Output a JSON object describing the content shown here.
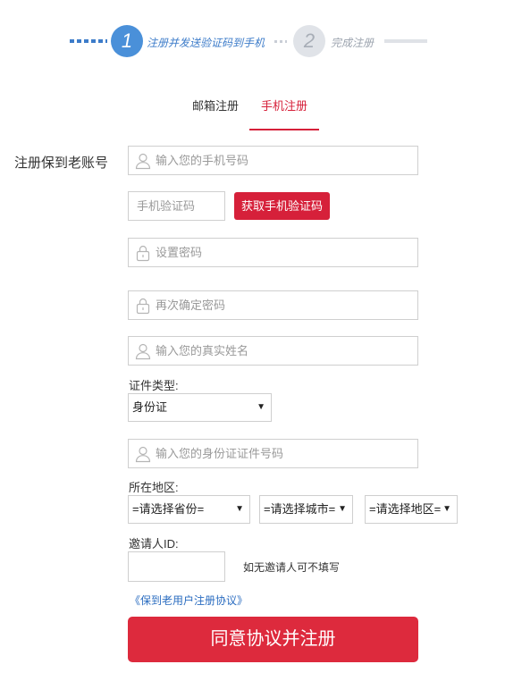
{
  "steps": {
    "step1_number": "1",
    "step1_label": "注册并发送验证码到手机",
    "step2_number": "2",
    "step2_label": "完成注册"
  },
  "tabs": {
    "email": "邮箱注册",
    "phone": "手机注册",
    "active": "phone"
  },
  "form": {
    "row_label": "注册保到老账号",
    "phone_placeholder": "输入您的手机号码",
    "code_placeholder": "手机验证码",
    "get_code_button": "获取手机验证码",
    "password_placeholder": "设置密码",
    "confirm_password_placeholder": "再次确定密码",
    "name_placeholder": "输入您的真实姓名",
    "id_type_label": "证件类型:",
    "id_type_value": "身份证",
    "id_number_placeholder": "输入您的身份证证件号码",
    "area_label": "所在地区:",
    "province_value": "=请选择省份=",
    "city_value": "=请选择城市=",
    "district_value": "=请选择地区=",
    "inviter_label": "邀请人ID:",
    "inviter_hint": "如无邀请人可不填写",
    "agreement_link": "《保到老用户注册协议》",
    "submit_button": "同意协议并注册"
  },
  "colors": {
    "accent_red": "#d6203a",
    "step_blue": "#4a90d9",
    "link_blue": "#2a6cc0"
  },
  "icons": [
    "user-icon",
    "lock-icon",
    "dropdown-arrow-icon"
  ]
}
